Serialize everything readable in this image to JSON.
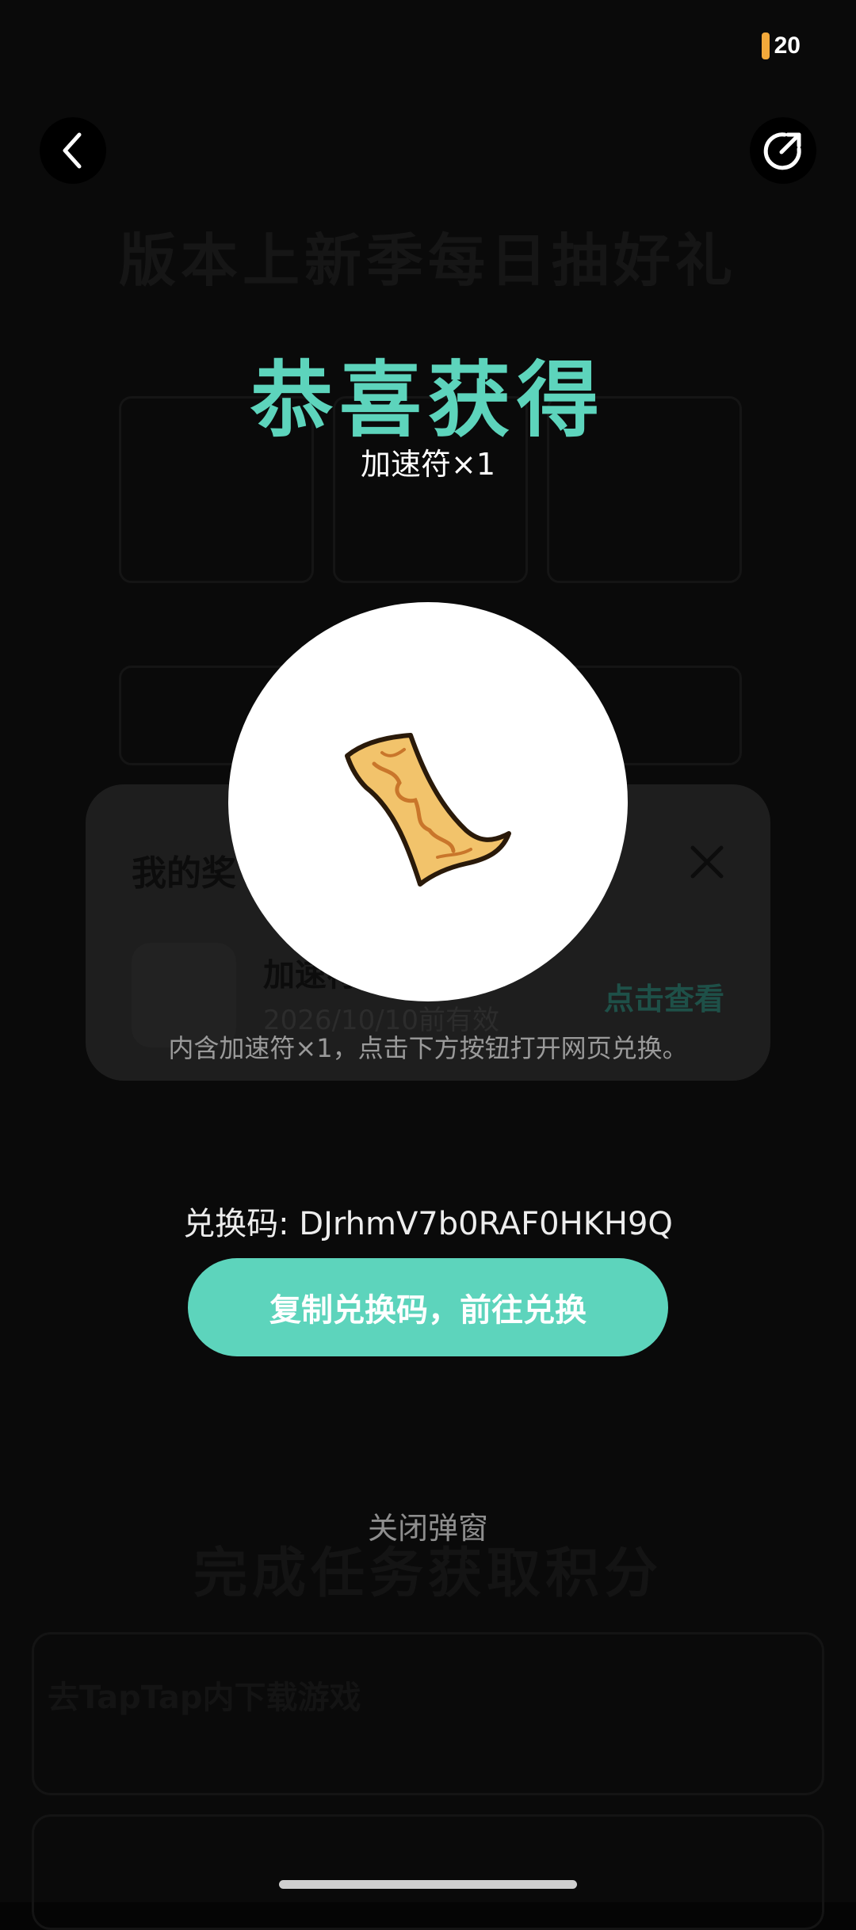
{
  "status_bar": {
    "battery_level": "20",
    "battery_color": "#f2a93b"
  },
  "background": {
    "banner_title": "版本上新季每日抽好礼",
    "section_title": "完成任务获取积分",
    "task_row": "去TapTap内下载游戏"
  },
  "modal": {
    "heading": "恭喜获得",
    "reward_name": "加速符×1",
    "reward_icon": "talisman-icon",
    "code_label": "兑换码: DJrhmV7b0RAF0HKH9Q",
    "copy_button": "复制兑换码，前往兑换",
    "close_label": "关闭弹窗",
    "accent_color": "#5dd4bc"
  },
  "rewards_panel": {
    "title": "我的奖",
    "item_name": "加速符",
    "item_expiry": "2026/10/10前有效",
    "view_label": "点击查看",
    "description": "内含加速符×1，点击下方按钮打开网页兑换。"
  }
}
